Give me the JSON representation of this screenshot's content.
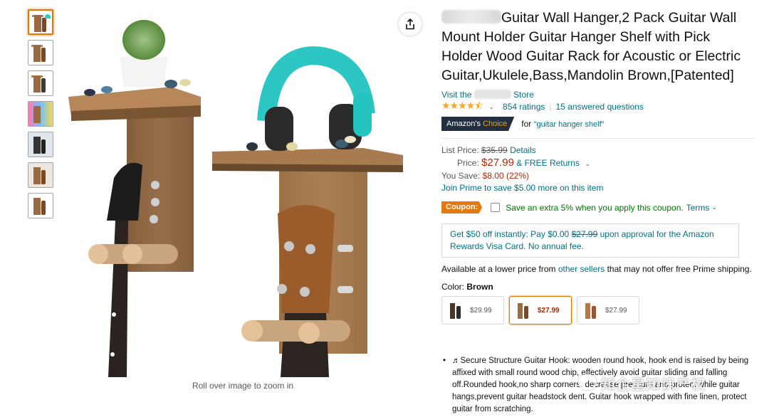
{
  "thumbnails": [
    {
      "name": "thumb-1",
      "active": true
    },
    {
      "name": "thumb-2",
      "active": false
    },
    {
      "name": "thumb-3",
      "active": false
    },
    {
      "name": "thumb-4",
      "active": false
    },
    {
      "name": "thumb-5",
      "active": false
    },
    {
      "name": "thumb-6",
      "active": false
    },
    {
      "name": "thumb-7",
      "active": false
    }
  ],
  "image": {
    "zoom_caption": "Roll over image to zoom in",
    "share_icon": "share-icon"
  },
  "product": {
    "title": "Guitar Wall Hanger,2 Pack Guitar Wall Mount Holder Guitar Hanger Shelf with Pick Holder Wood Guitar Rack for Acoustic or Electric Guitar,Ukulele,Bass,Mandolin Brown,[Patented]",
    "visit_prefix": "Visit the",
    "visit_suffix": "Store",
    "rating_stars": "★★★★⯪",
    "ratings_count": "854 ratings",
    "answered": "15 answered questions",
    "choice_badge_a": "Amazon's",
    "choice_badge_b": "Choice",
    "choice_for": "for",
    "choice_keyword": "\"guitar hanger shelf\""
  },
  "pricing": {
    "list_label": "List Price:",
    "list_price": "$35.99",
    "details": "Details",
    "price_label": "Price:",
    "price": "$27.99",
    "free_returns": "& FREE Returns",
    "save_label": "You Save:",
    "save_value": "$8.00 (22%)",
    "prime_link": "Join Prime to save $5.00 more on this item"
  },
  "coupon": {
    "badge": "Coupon:",
    "text": "Save an extra 5% when you apply this coupon.",
    "terms": "Terms"
  },
  "card_offer": {
    "line1_a": "Get $50 off instantly: Pay $0.00",
    "line1_strike": "$27.99",
    "line1_b": "upon approval for the Amazon",
    "line2": "Rewards Visa Card. No annual fee."
  },
  "availability": {
    "prefix": "Available at a lower price from",
    "link": "other sellers",
    "suffix": "that may not offer free Prime shipping."
  },
  "color": {
    "label": "Color:",
    "value": "Brown",
    "swatches": [
      {
        "price": "$29.99",
        "board": "#4a3526",
        "guitar": "#2b2b2b"
      },
      {
        "price": "$27.99",
        "board": "#9a6b43",
        "guitar": "#7b4a24"
      },
      {
        "price": "$27.99",
        "board": "#b07a4a",
        "guitar": "#a0522d"
      }
    ]
  },
  "bullets": [
    "♬Secure Structure Guitar Hook: wooden round hook, hook end is raised by being affixed with small round wood chip, effectively avoid guitar sliding and falling off.Rounded hook,no sharp corners, decrease pressure and protect while guitar hangs,prevent guitar headstock dent. Guitar hook wrapped with fine linen, protect guitar from scratching."
  ],
  "watermark": "知企星知识产权",
  "colors": {
    "link": "#007185",
    "price": "#b12704",
    "star": "#ffa41c",
    "coupon": "#e47911",
    "selected": "#e77600"
  }
}
